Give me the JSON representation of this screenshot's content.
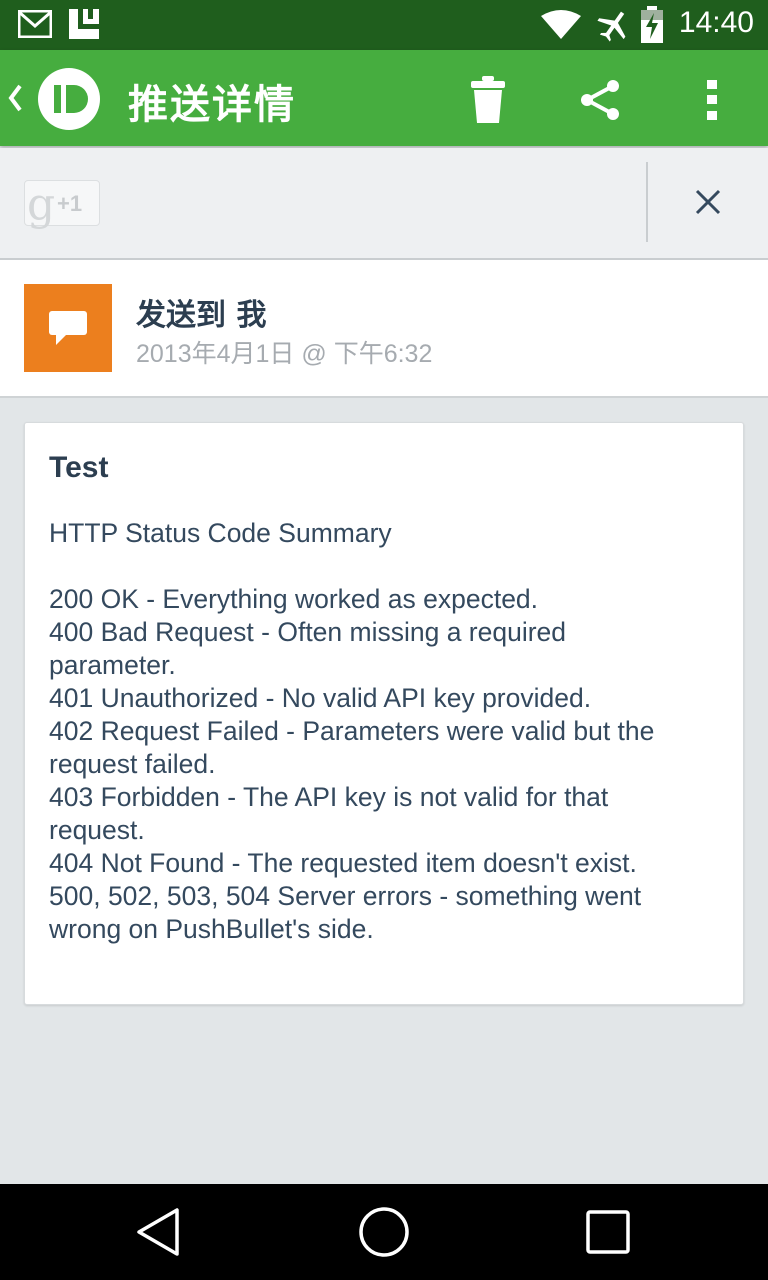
{
  "status_bar": {
    "time": "14:40",
    "icons": [
      "gmail-icon",
      "app-l-icon",
      "wifi-icon",
      "airplane-icon",
      "battery-charging-icon"
    ]
  },
  "app_bar": {
    "title": "推送详情",
    "logo_icon": "pushbullet-logo-icon",
    "actions": [
      "delete-icon",
      "share-icon",
      "overflow-menu-icon"
    ]
  },
  "gplus_bar": {
    "button_g": "g",
    "button_label": "+1",
    "close_icon": "close-icon"
  },
  "push": {
    "icon": "note-icon",
    "recipient": "发送到 我",
    "date": "2013年4月1日 @ 下午6:32"
  },
  "note": {
    "title": "Test",
    "body_lines": [
      "HTTP Status Code Summary",
      "",
      "200 OK - Everything worked as expected.",
      "400 Bad Request - Often missing a required",
      "parameter.",
      "401 Unauthorized - No valid API key provided.",
      "402 Request Failed - Parameters were valid but the",
      "request failed.",
      "403 Forbidden - The API key is not valid for that",
      "request.",
      "404 Not Found - The requested item doesn't exist.",
      "500, 502, 503, 504 Server errors - something went",
      "wrong on PushBullet's side."
    ]
  },
  "nav_bar": {
    "buttons": [
      "back-icon",
      "home-icon",
      "recents-icon"
    ]
  },
  "colors": {
    "app_bar": "#46ad3f",
    "status_bar": "#1f5e1d",
    "push_icon_bg": "#ec7f1e",
    "background": "#e2e6e8"
  }
}
